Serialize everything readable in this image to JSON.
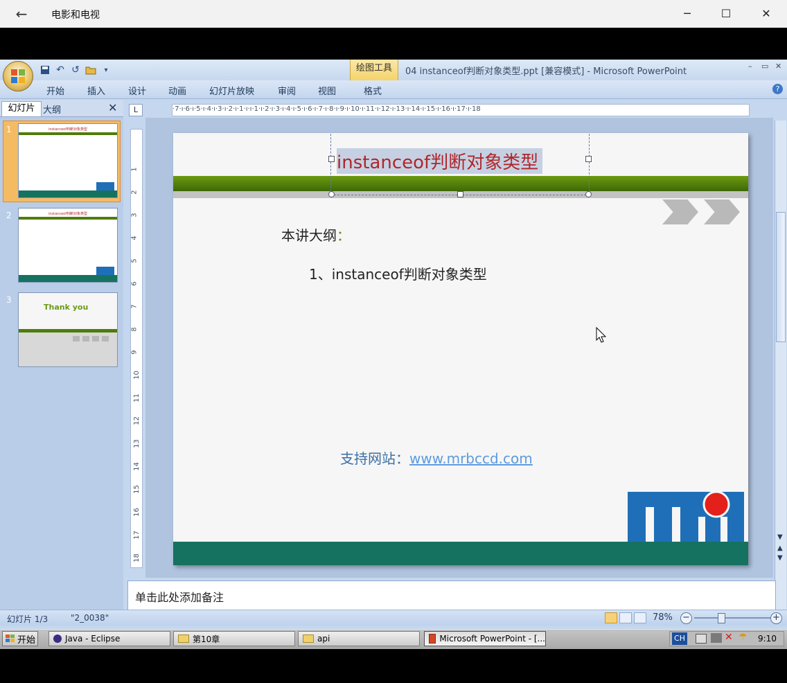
{
  "player": {
    "title": "电影和电视",
    "back_icon": "←",
    "minimize_icon": "─",
    "maximize_icon": "☐",
    "close_icon": "✕"
  },
  "ppt": {
    "drawing_tools": "绘图工具",
    "doc_title": "04 instanceof判断对象类型.ppt [兼容模式] - Microsoft PowerPoint",
    "window_controls": [
      "–",
      "▭",
      "✕"
    ],
    "tabs": [
      "开始",
      "插入",
      "设计",
      "动画",
      "幻灯片放映",
      "审阅",
      "视图",
      "格式"
    ],
    "help_icon": "?"
  },
  "left_pane": {
    "tab_slides": "幻灯片",
    "tab_outline": "大纲",
    "close_icon": "✕",
    "thumbnails": [
      {
        "num": "1",
        "title": "instanceof判断对象类型"
      },
      {
        "num": "2",
        "title": "instanceof判断对象类型"
      },
      {
        "num": "3",
        "title": "Thank you"
      }
    ]
  },
  "ruler": {
    "corner": "L",
    "horizontal": "·7·ı·6·ı·5·ı·4·ı·3·ı·2·ı·1·ı·ı·1·ı·2·ı·3·ı·4·ı·5·ı·6·ı·7·ı·8·ı·9·ı·10·ı·11·ı·12·ı·13·ı·14·ı·15·ı·16·ı·17·ı·18",
    "vertical": [
      "1",
      "2",
      "3",
      "4",
      "5",
      "6",
      "7",
      "8",
      "9",
      "10",
      "11",
      "12",
      "13",
      "14",
      "15",
      "16",
      "17",
      "18"
    ]
  },
  "slide": {
    "title": "instanceof判断对象类型",
    "outline_heading": "本讲大纲",
    "outline_colon": "：",
    "outline_item": "1、instanceof判断对象类型",
    "site_label": "支持网站：",
    "site_link": "www.mrbccd.com"
  },
  "notes": {
    "placeholder": "单击此处添加备注"
  },
  "status": {
    "slide": "幻灯片 1/3",
    "theme": "\"2_0038\"",
    "zoom": "78%",
    "zoom_level_percent": 78,
    "zoom_out": "−",
    "zoom_in": "+"
  },
  "taskbar": {
    "start": "开始",
    "tasks": [
      {
        "label": "Java - Eclipse",
        "icon": "eclipse-icon"
      },
      {
        "label": "第10章",
        "icon": "folder-icon"
      },
      {
        "label": "api",
        "icon": "folder-icon"
      },
      {
        "label": "Microsoft PowerPoint - [...",
        "icon": "powerpoint-icon"
      }
    ],
    "ime": "CH",
    "clock": "9:10"
  },
  "colors": {
    "title_red": "#b0262b",
    "slide_green": "#4f7c0a",
    "slide_teal": "#157260",
    "link_blue": "#5d9be0"
  }
}
